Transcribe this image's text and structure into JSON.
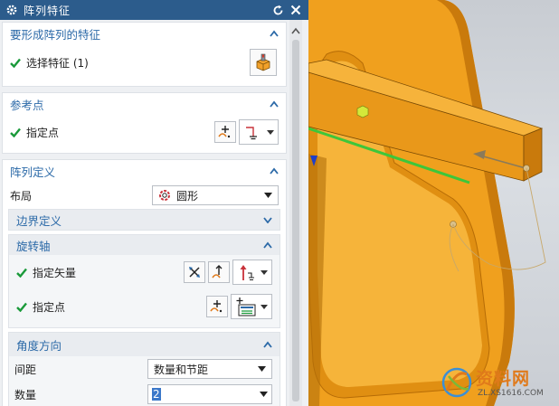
{
  "dialog": {
    "title": "阵列特征",
    "sections": {
      "feature": {
        "title": "要形成阵列的特征",
        "select_label": "选择特征 (1)"
      },
      "ref_point": {
        "title": "参考点",
        "point_label": "指定点"
      },
      "pattern_def": {
        "title": "阵列定义",
        "layout_label": "布局",
        "layout_value": "圆形",
        "boundary": {
          "title": "边界定义"
        },
        "rotation_axis": {
          "title": "旋转轴",
          "vector_label": "指定矢量",
          "point_label": "指定点"
        },
        "angle_dir": {
          "title": "角度方向",
          "spacing_label": "间距",
          "spacing_value": "数量和节距",
          "count_label": "数量",
          "count_value": "2"
        }
      }
    }
  },
  "watermark": {
    "brand": "资料网",
    "url": "ZL.XS1616.COM"
  },
  "colors": {
    "titlebar": "#2c5c8c",
    "accent": "#2c6aa8",
    "check": "#1a9a3a",
    "part": "#f0a01e"
  }
}
